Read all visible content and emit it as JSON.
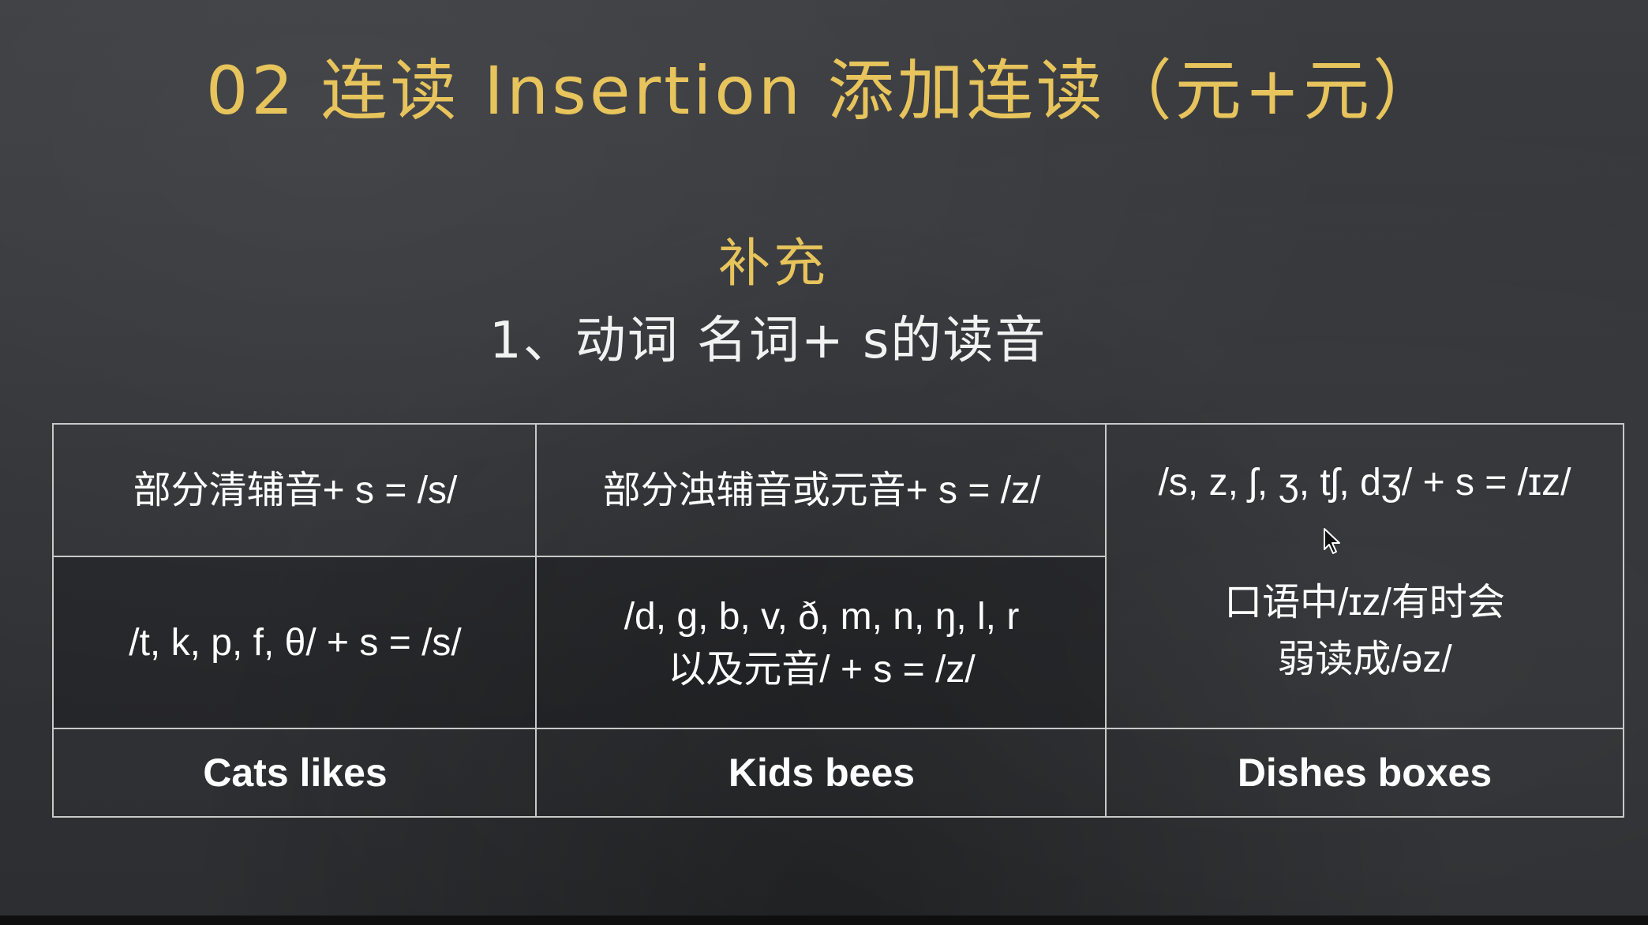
{
  "slide": {
    "title": "02 连读 Insertion 添加连读（元+元）",
    "subtitle": "补充",
    "heading": "1、动词 名词+ s的读音"
  },
  "table": {
    "row1": {
      "col1": "部分清辅音+ s = /s/",
      "col2": "部分浊辅音或元音+ s = /z/",
      "col3": "/s, z, ʃ, ʒ, tʃ, dʒ/ + s = /ɪz/"
    },
    "row2": {
      "col1": "/t, k, p, f, θ/ + s = /s/",
      "col2_line1": "/d, g, b, v, ð, m, n, ŋ, l, r",
      "col2_line2": "以及元音/ + s = /z/",
      "col3_line1": "口语中/ɪz/有时会",
      "col3_line2": "弱读成/əz/"
    },
    "row3": {
      "col1": "Cats likes",
      "col2": "Kids bees",
      "col3": "Dishes boxes"
    }
  },
  "colors": {
    "title": "#e7c45c",
    "text": "#ffffff",
    "background": "#323438",
    "grid": "#c9c9c9"
  },
  "icons": {
    "cursor": "mouse-pointer-icon"
  }
}
